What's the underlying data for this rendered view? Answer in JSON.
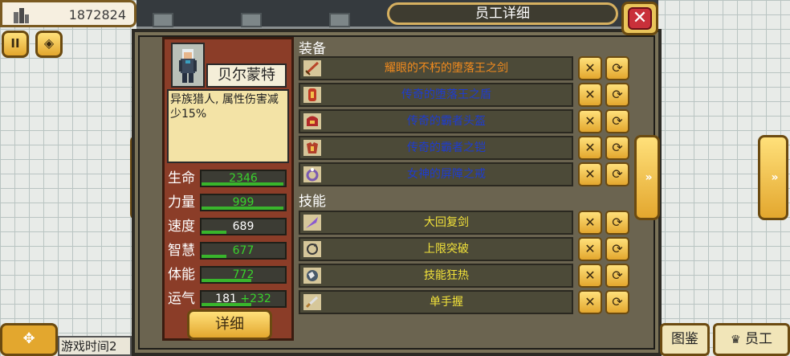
{
  "header": {
    "money_value": "1872824",
    "money_icon": "building-icon",
    "title": "员工详细",
    "close_label": "✕"
  },
  "toolbar": {
    "pause_label": "II",
    "speed_label": "◈"
  },
  "employee": {
    "name": "贝尔蒙特",
    "description": "异族猎人, 属性伤害减少15%",
    "detail_button": "详细",
    "stats": [
      {
        "label": "生命",
        "value": "2346",
        "color": "#39d22c",
        "fill": 0.98
      },
      {
        "label": "力量",
        "value": "999",
        "color": "#39d22c",
        "fill": 0.98
      },
      {
        "label": "速度",
        "value": "689",
        "color": "#ffffff",
        "fill": 0.3
      },
      {
        "label": "智慧",
        "value": "677",
        "color": "#39d22c",
        "fill": 0.3
      },
      {
        "label": "体能",
        "value": "772",
        "color": "#39d22c",
        "fill": 0.6
      },
      {
        "label": "运气",
        "value": "181",
        "bonus": "+232",
        "color": "#ffffff",
        "fill": 0.6
      }
    ]
  },
  "equipment": {
    "heading": "装备",
    "items": [
      {
        "name": "耀眼的不朽的堕落王之剑",
        "color": "#f08a1e",
        "icon": "sword-icon"
      },
      {
        "name": "传奇的堕落王之盾",
        "color": "#1e3ccf",
        "icon": "shield-icon"
      },
      {
        "name": "传奇的霸者头盔",
        "color": "#1e3ccf",
        "icon": "helmet-icon"
      },
      {
        "name": "传奇的霸者之铠",
        "color": "#1e3ccf",
        "icon": "armor-icon"
      },
      {
        "name": "女神的屏障之戒",
        "color": "#1e3ccf",
        "icon": "ring-icon"
      }
    ]
  },
  "skills": {
    "heading": "技能",
    "items": [
      {
        "name": "大回复剑",
        "color": "#f2e23a",
        "icon": "feather-icon"
      },
      {
        "name": "上限突破",
        "color": "#f2e23a",
        "icon": "cycle-icon"
      },
      {
        "name": "技能狂热",
        "color": "#f2e23a",
        "icon": "globe-icon"
      },
      {
        "name": "单手握",
        "color": "#f2e23a",
        "icon": "blade-icon"
      }
    ]
  },
  "row_actions": {
    "remove_label": "✕",
    "swap_label": "⟳"
  },
  "footer": {
    "game_time_label": "游戏时间2",
    "catalog_label": "图鉴",
    "staff_label": "员工"
  }
}
